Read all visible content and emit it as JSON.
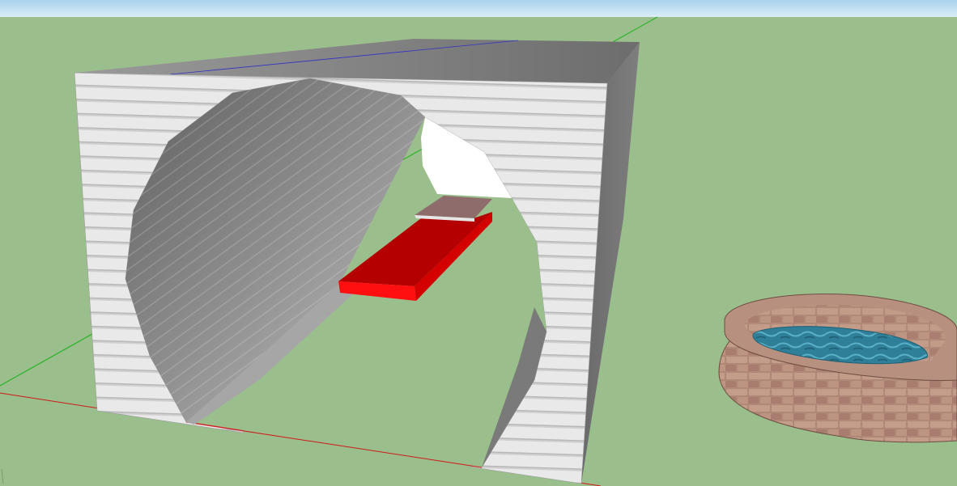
{
  "app": {
    "type": "3d-modeling-viewport"
  },
  "viewport": {
    "sky_color": "#c7e2f2",
    "ground_color": "#9bbf8c"
  },
  "axes": {
    "red_color": "#d01818",
    "green_color": "#18b018",
    "blue_color": "#3030c8"
  },
  "scene": {
    "objects": [
      {
        "name": "arched-shelter",
        "color": "#e6e6e6"
      },
      {
        "name": "red-bench",
        "color": "#d40000"
      },
      {
        "name": "brick-pond",
        "color": "#a87c6e",
        "water_color": "#2f7f98"
      }
    ]
  }
}
